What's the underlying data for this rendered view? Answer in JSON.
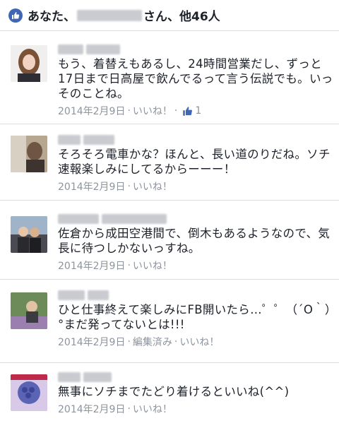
{
  "header": {
    "prefix": "あなた、",
    "suffix": "さん、他46人"
  },
  "comments": [
    {
      "text": "もう、着替えもあるし、24時間営業だし、ずっと17日まで日高屋で飲んでるって言う伝説でも。いっそのことね。",
      "date": "2014年2月9日",
      "like_label": "いいね！",
      "reaction_count": "1"
    },
    {
      "text": "そろそろ電車かな？ほんと、長い道のりだね。ソチ速報楽しみにしてるからーーー！",
      "date": "2014年2月9日",
      "like_label": "いいね！"
    },
    {
      "text": "佐倉から成田空港間で、倒木もあるようなので、気長に待つしかないっすね。",
      "date": "2014年2月9日",
      "like_label": "いいね！"
    },
    {
      "text": "ひと仕事終えて楽しみにFB開いたら…゜゜（´O｀）°まだ発ってないとは!!!",
      "date": "2014年2月9日",
      "edited_label": "編集済み",
      "like_label": "いいね！"
    },
    {
      "text": "無事にソチまでたどり着けるといいね(^^)",
      "date": "2014年2月9日",
      "like_label": "いいね！"
    }
  ],
  "colors": {
    "accent": "#4267b2",
    "meta": "#8d949e",
    "divider": "#dcdee3"
  }
}
